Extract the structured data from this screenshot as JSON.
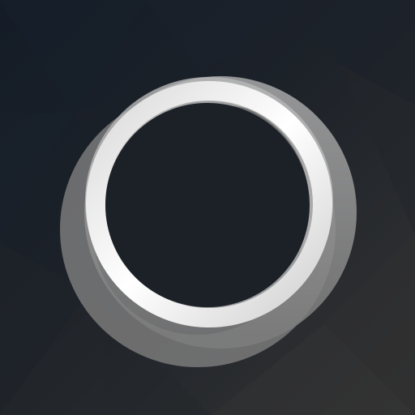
{
  "app_icon": {
    "icon_name": "ring-logo-icon",
    "background_colors": [
      "#15202b",
      "#1e2329",
      "#2b2b2b",
      "#333333"
    ],
    "ring_colors": [
      "#ffffff",
      "#eeeeee",
      "#bfbfbf",
      "#8c8c8c",
      "#6b6b6b"
    ]
  }
}
